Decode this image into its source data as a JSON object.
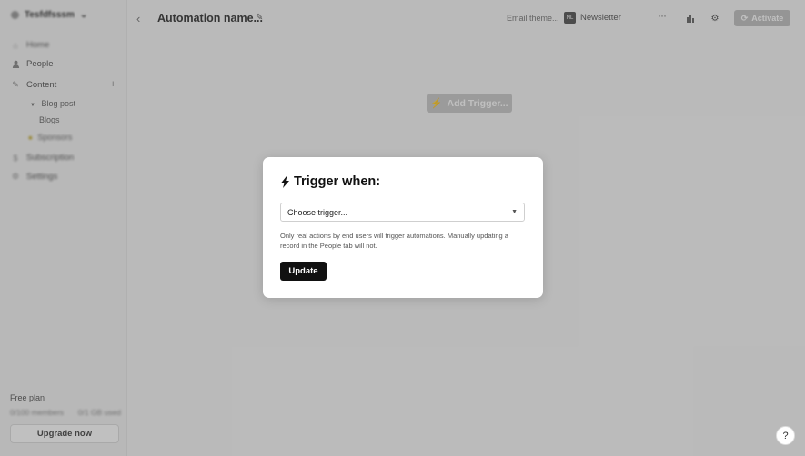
{
  "sidebar": {
    "workspace": "Tesfdfsssm",
    "items": [
      {
        "label": "Home",
        "icon": "home-icon"
      },
      {
        "label": "People",
        "icon": "person-icon"
      },
      {
        "label": "Content",
        "icon": "pencil-icon"
      },
      {
        "label": "Subscription",
        "icon": "dollar-icon"
      },
      {
        "label": "Settings",
        "icon": "gear-icon"
      }
    ],
    "content_sub": {
      "parent": "Blog post",
      "child": "Blogs",
      "highlight": "Sponsors"
    },
    "plus": "+",
    "free_plan": "Free plan",
    "usage_left": "0/100 members",
    "usage_right": "0/1 GB used",
    "upgrade": "Upgrade now"
  },
  "topbar": {
    "back": "‹",
    "automation_name": "Automation name...",
    "email_theme": "Email theme...",
    "newsletter_badge": "NL",
    "newsletter": "Newsletter",
    "more": "···",
    "activate": "Activate"
  },
  "canvas": {
    "add_trigger": "Add Trigger..."
  },
  "modal": {
    "title": "Trigger when:",
    "select_value": "Choose trigger...",
    "help_text": "Only real actions by end users will trigger automations. Manually updating a record in the People tab will not.",
    "update": "Update"
  },
  "help_button": "?",
  "colors": {
    "primary_button": "#111111",
    "overlay": "rgba(60,60,60,0.32)"
  }
}
